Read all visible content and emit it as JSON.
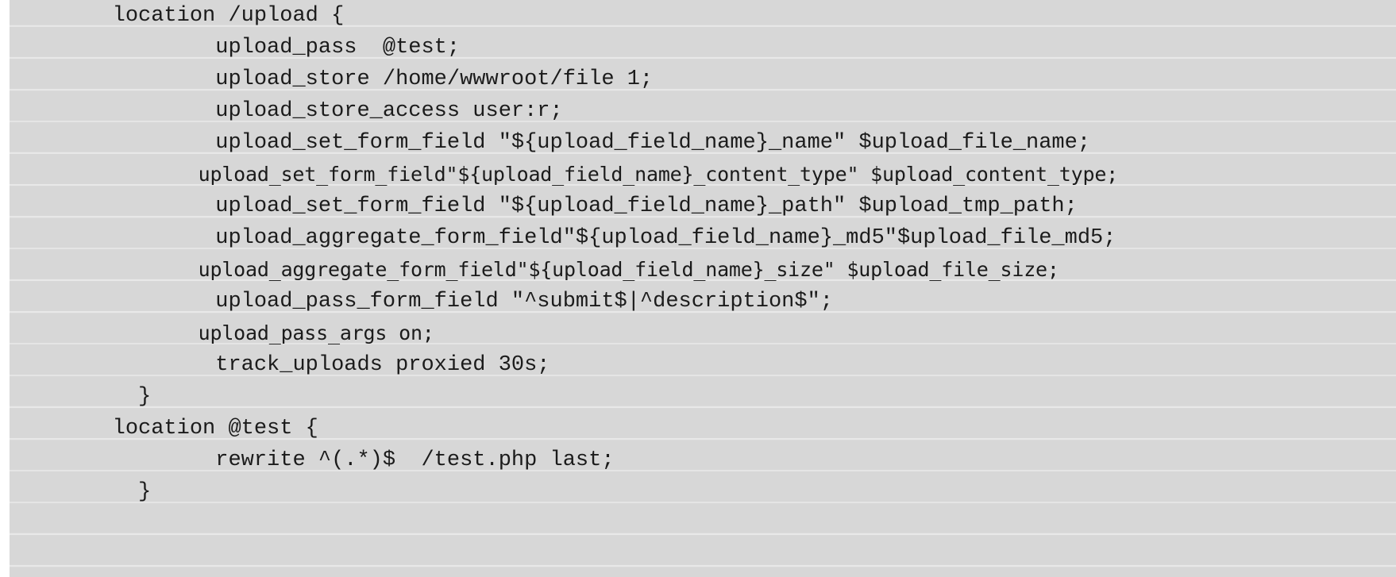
{
  "code_block": {
    "language": "nginx",
    "background_color": "#d7d7d7",
    "text_color": "#1b1b1b",
    "lines": [
      {
        "text": "        location /upload {",
        "font": "serif-mono"
      },
      {
        "text": "                upload_pass  @test;",
        "font": "serif-mono"
      },
      {
        "text": "                upload_store /home/wwwroot/file 1;",
        "font": "serif-mono"
      },
      {
        "text": "                upload_store_access user:r;",
        "font": "serif-mono"
      },
      {
        "text": "                upload_set_form_field \"${upload_field_name}_name\" $upload_file_name;",
        "font": "serif-mono"
      },
      {
        "text": "                upload_set_form_field\"${upload_field_name}_content_type\" $upload_content_type;",
        "font": "sans-mono"
      },
      {
        "text": "                upload_set_form_field \"${upload_field_name}_path\" $upload_tmp_path;",
        "font": "serif-mono"
      },
      {
        "text": "                upload_aggregate_form_field\"${upload_field_name}_md5\"$upload_file_md5;",
        "font": "serif-mono"
      },
      {
        "text": "                upload_aggregate_form_field\"${upload_field_name}_size\" $upload_file_size;",
        "font": "sans-mono"
      },
      {
        "text": "                upload_pass_form_field \"^submit$|^description$\";",
        "font": "serif-mono"
      },
      {
        "text": "                upload_pass_args on;",
        "font": "sans-mono"
      },
      {
        "text": "                track_uploads proxied 30s;",
        "font": "serif-mono"
      },
      {
        "text": "          }",
        "font": "serif-mono"
      },
      {
        "text": "        location @test {",
        "font": "serif-mono"
      },
      {
        "text": "                rewrite ^(.*)$  /test.php last;",
        "font": "serif-mono"
      },
      {
        "text": "          }",
        "font": "serif-mono"
      }
    ]
  }
}
